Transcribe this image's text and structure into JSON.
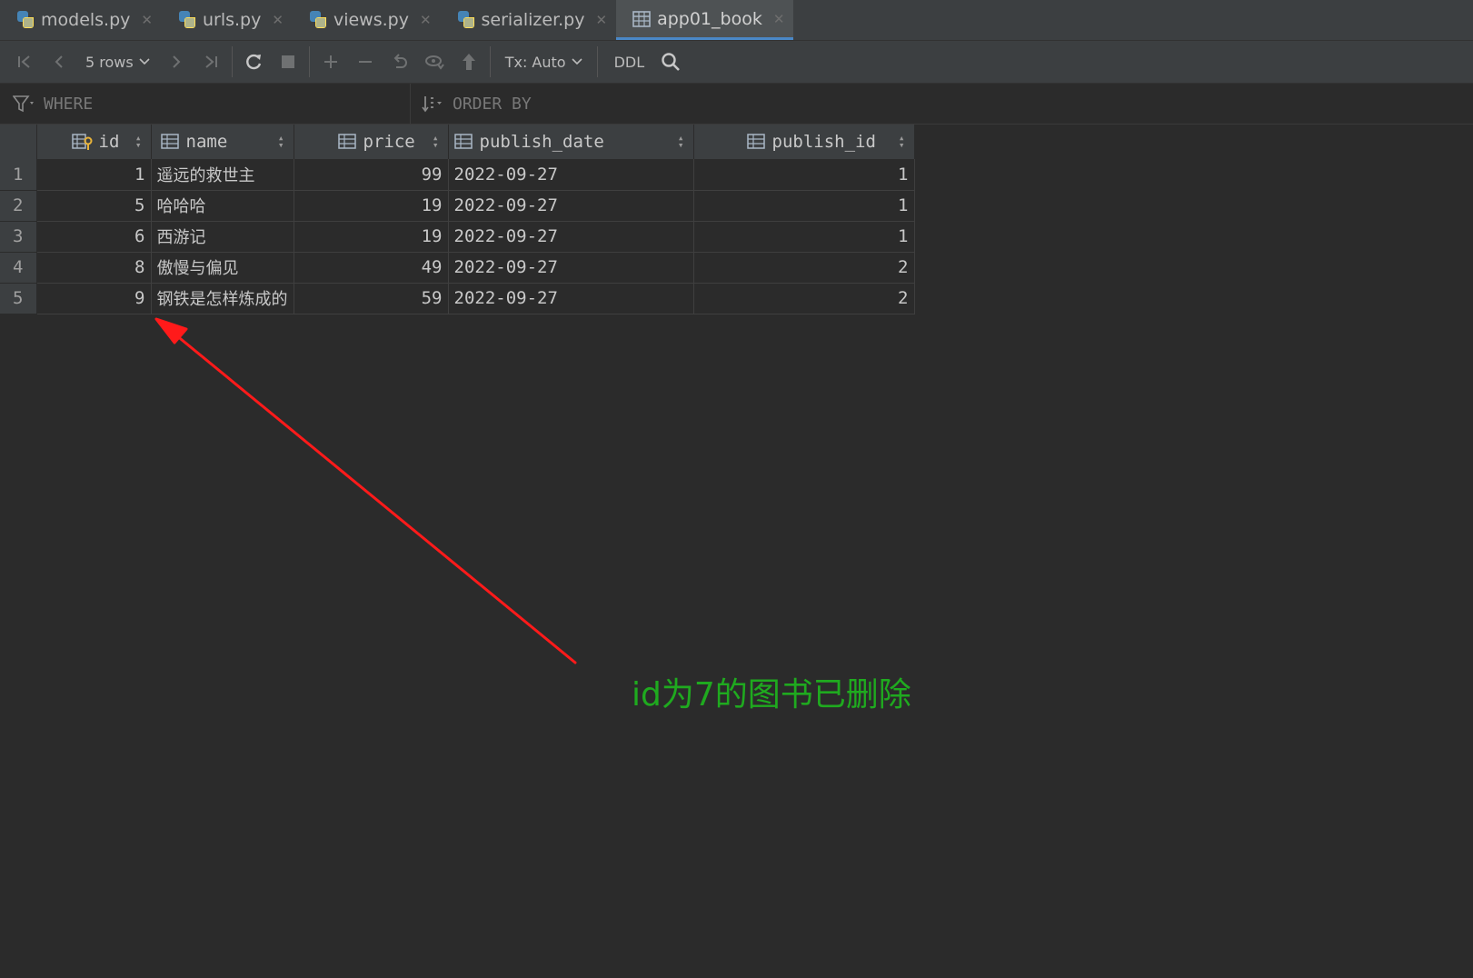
{
  "tabs": [
    {
      "label": "models.py",
      "icon": "python-file-icon",
      "active": false
    },
    {
      "label": "urls.py",
      "icon": "python-file-icon",
      "active": false
    },
    {
      "label": "views.py",
      "icon": "python-file-icon",
      "active": false
    },
    {
      "label": "serializer.py",
      "icon": "python-file-icon",
      "active": false
    },
    {
      "label": "app01_book",
      "icon": "table-icon",
      "active": true
    }
  ],
  "toolbar": {
    "rows_label": "5 rows",
    "tx_label": "Tx: Auto",
    "ddl_label": "DDL"
  },
  "filter": {
    "where_label": "WHERE",
    "order_by_label": "ORDER BY"
  },
  "table": {
    "columns": [
      "id",
      "name",
      "price",
      "publish_date",
      "publish_id"
    ],
    "rows": [
      {
        "num": "1",
        "id": "1",
        "name": "遥远的救世主",
        "price": "99",
        "publish_date": "2022-09-27",
        "publish_id": "1"
      },
      {
        "num": "2",
        "id": "5",
        "name": "哈哈哈",
        "price": "19",
        "publish_date": "2022-09-27",
        "publish_id": "1"
      },
      {
        "num": "3",
        "id": "6",
        "name": "西游记",
        "price": "19",
        "publish_date": "2022-09-27",
        "publish_id": "1"
      },
      {
        "num": "4",
        "id": "8",
        "name": "傲慢与偏见",
        "price": "49",
        "publish_date": "2022-09-27",
        "publish_id": "2"
      },
      {
        "num": "5",
        "id": "9",
        "name": "钢铁是怎样炼成的",
        "price": "59",
        "publish_date": "2022-09-27",
        "publish_id": "2"
      }
    ]
  },
  "annotation": {
    "text": "id为7的图书已删除",
    "text_color": "#1faa1f",
    "arrow_color": "#ff1a1a"
  },
  "colors": {
    "background": "#2b2b2b",
    "panel": "#3c3f41",
    "active_tab_underline": "#4a88c7"
  }
}
